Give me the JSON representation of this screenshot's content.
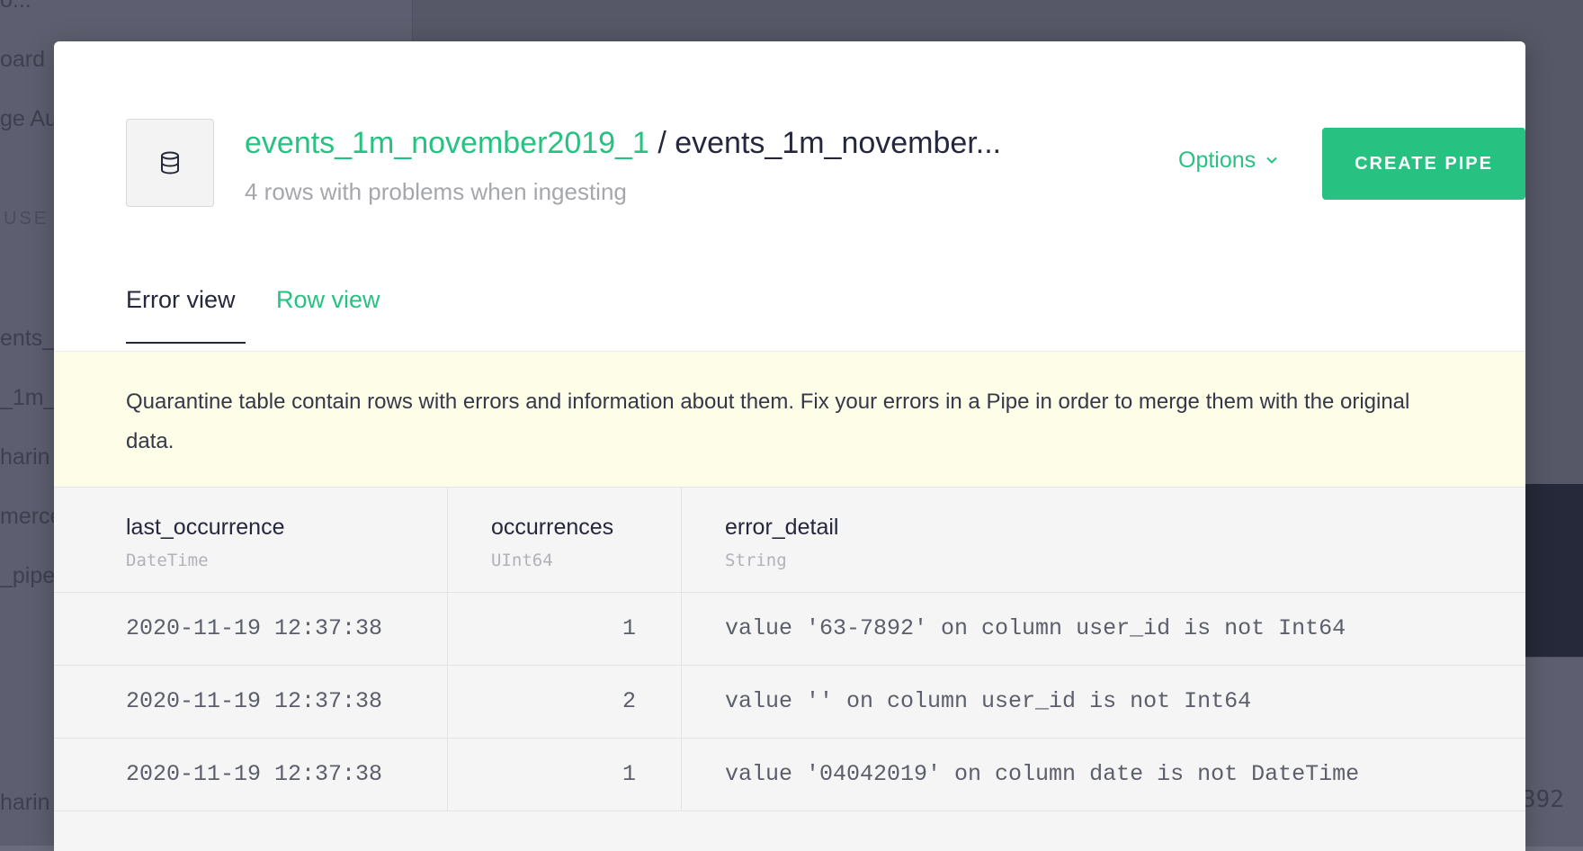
{
  "background": {
    "sidebar_fragments": [
      "oard",
      "ge Au",
      "USE",
      "ents_",
      "_1m_",
      "harin",
      "merce",
      "_pipe",
      "harin"
    ],
    "main_fragment": "392"
  },
  "modal": {
    "datasource_link": "events_1m_november2019_1",
    "title_separator": "/",
    "title_rest": "events_1m_november...",
    "subtitle": "4 rows with problems when ingesting",
    "options_label": "Options",
    "create_pipe_label": "CREATE PIPE",
    "tabs": [
      {
        "label": "Error view",
        "active": true
      },
      {
        "label": "Row view",
        "active": false
      }
    ],
    "notice": "Quarantine table contain rows with errors and information about them. Fix your errors in a Pipe in order to merge them with the original data.",
    "table": {
      "columns": [
        {
          "name": "last_occurrence",
          "type": "DateTime"
        },
        {
          "name": "occurrences",
          "type": "UInt64"
        },
        {
          "name": "error_detail",
          "type": "String"
        }
      ],
      "rows": [
        {
          "last_occurrence": "2020-11-19 12:37:38",
          "occurrences": "1",
          "error_detail": "value '63-7892' on column user_id is not Int64"
        },
        {
          "last_occurrence": "2020-11-19 12:37:38",
          "occurrences": "2",
          "error_detail": "value '' on column user_id is not Int64"
        },
        {
          "last_occurrence": "2020-11-19 12:37:38",
          "occurrences": "1",
          "error_detail": "value '04042019' on column date is not DateTime"
        }
      ]
    }
  },
  "colors": {
    "accent": "#27c281",
    "text": "#25283d",
    "notice_bg": "#fdfde8"
  },
  "icons": {
    "datasource": "database-icon",
    "options": "chevron-down-icon"
  }
}
